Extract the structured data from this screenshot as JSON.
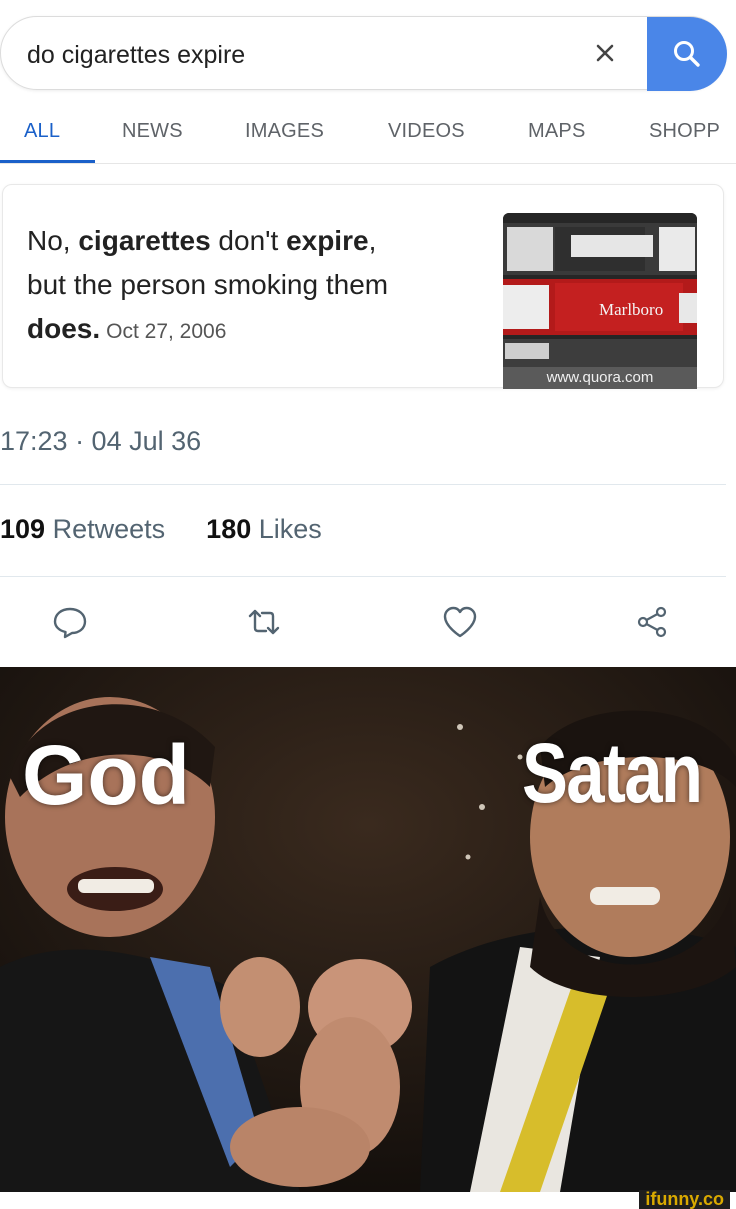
{
  "search": {
    "query": "do cigarettes expire",
    "clear_symbol": "×"
  },
  "tabs": [
    {
      "label": "ALL",
      "active": true
    },
    {
      "label": "NEWS"
    },
    {
      "label": "IMAGES"
    },
    {
      "label": "VIDEOS"
    },
    {
      "label": "MAPS"
    },
    {
      "label": "SHOPP"
    }
  ],
  "answer_card": {
    "line1_a": "No, ",
    "line1_b": "cigarettes",
    "line1_c": " don't ",
    "line1_d": "expire",
    "line1_e": ",",
    "line2": "but the person smoking them",
    "line3_b": "does.",
    "date": "Oct 27, 2006",
    "image_source": "www.quora.com",
    "image_brand": "Marlboro"
  },
  "tweet": {
    "timestamp": "17:23 · 04 Jul 36",
    "retweets_count": "109",
    "retweets_label": "Retweets",
    "likes_count": "180",
    "likes_label": "Likes"
  },
  "meme": {
    "label_left": "God",
    "label_right": "Satan"
  },
  "watermark": "ifunny.co",
  "colors": {
    "accent": "#1a60c9",
    "search_button": "#4a86e8",
    "meta_text": "#536471"
  }
}
